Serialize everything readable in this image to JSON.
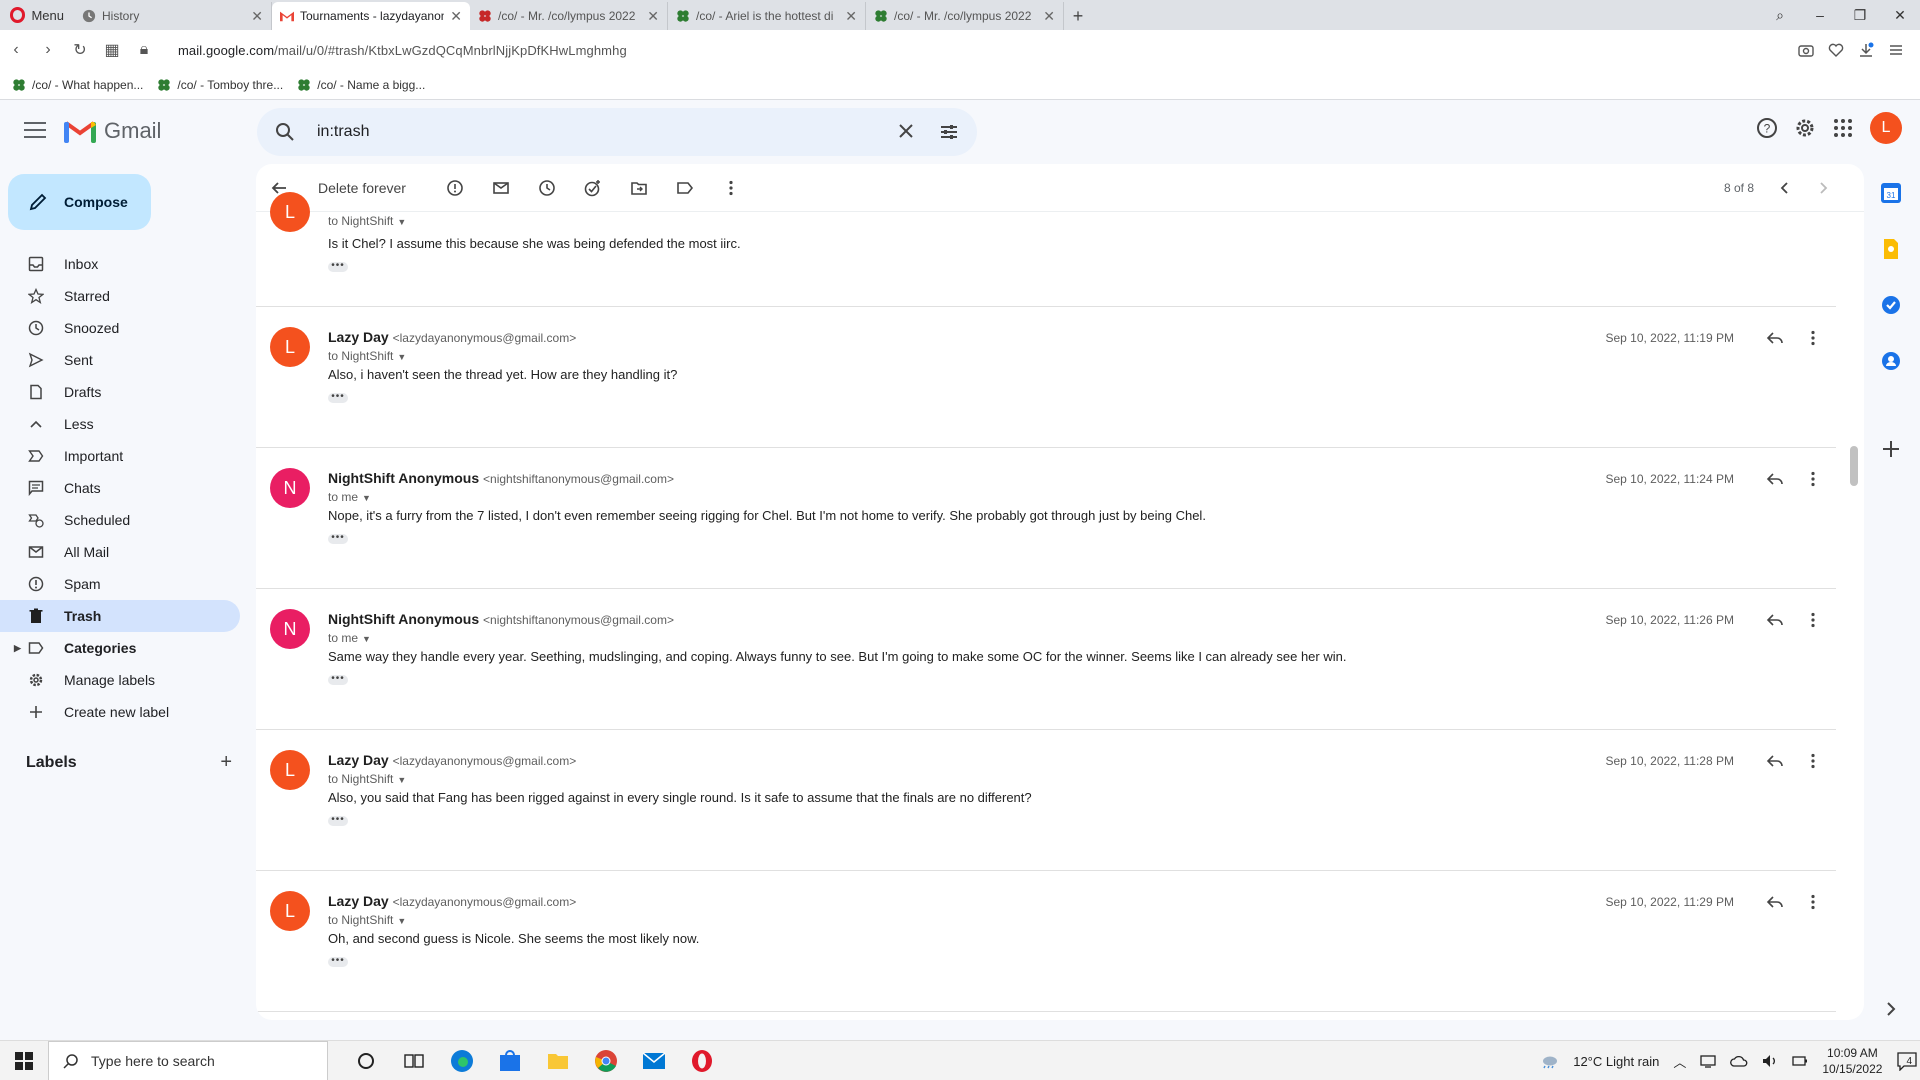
{
  "browser": {
    "menu_label": "Menu",
    "tabs": [
      {
        "title": "History",
        "active": false
      },
      {
        "title": "Tournaments - lazydayanon",
        "active": true
      },
      {
        "title": "/co/ - Mr. /co/lympus 2022",
        "active": false
      },
      {
        "title": "/co/ - Ariel is the hottest di",
        "active": false
      },
      {
        "title": "/co/ - Mr. /co/lympus 2022",
        "active": false
      }
    ],
    "url_domain": "mail.google.com",
    "url_path": "/mail/u/0/#trash/KtbxLwGzdQCqMnbrlNjjKpDfKHwLmghmhg",
    "bookmarks": [
      "/co/ - What happen...",
      "/co/ - Tomboy thre...",
      "/co/ - Name a bigg..."
    ]
  },
  "gmail": {
    "brand": "Gmail",
    "search_value": "in:trash",
    "account_initial": "L",
    "compose_label": "Compose",
    "nav": [
      {
        "label": "Inbox",
        "icon": "inbox-icon"
      },
      {
        "label": "Starred",
        "icon": "star-icon"
      },
      {
        "label": "Snoozed",
        "icon": "clock-icon"
      },
      {
        "label": "Sent",
        "icon": "send-icon"
      },
      {
        "label": "Drafts",
        "icon": "draft-icon"
      },
      {
        "label": "Less",
        "icon": "chevron-up-icon"
      },
      {
        "label": "Important",
        "icon": "important-icon"
      },
      {
        "label": "Chats",
        "icon": "chat-icon"
      },
      {
        "label": "Scheduled",
        "icon": "scheduled-icon"
      },
      {
        "label": "All Mail",
        "icon": "all-mail-icon"
      },
      {
        "label": "Spam",
        "icon": "spam-icon"
      },
      {
        "label": "Trash",
        "icon": "trash-icon"
      },
      {
        "label": "Categories",
        "icon": "label-icon"
      },
      {
        "label": "Manage labels",
        "icon": "gear-icon"
      },
      {
        "label": "Create new label",
        "icon": "plus-icon"
      }
    ],
    "labels_header": "Labels",
    "toolbar": {
      "delete_forever": "Delete forever",
      "pagination": "8 of 8"
    },
    "first_message": {
      "to": "to NightShift",
      "body": "Is it Chel? I assume this because she was being defended the most iirc."
    },
    "messages": [
      {
        "initial": "L",
        "name": "Lazy Day",
        "email": "<lazydayanonymous@gmail.com>",
        "to": "to NightShift",
        "date": "Sep 10, 2022, 11:19 PM",
        "body": "Also, i haven't seen the thread yet. How are they handling it?"
      },
      {
        "initial": "N",
        "name": "NightShift Anonymous",
        "email": "<nightshiftanonymous@gmail.com>",
        "to": "to me",
        "date": "Sep 10, 2022, 11:24 PM",
        "body": "Nope, it's a furry from the 7 listed, I don't even remember seeing rigging for Chel. But I'm not home to verify. She probably got through just by being Chel."
      },
      {
        "initial": "N",
        "name": "NightShift Anonymous",
        "email": "<nightshiftanonymous@gmail.com>",
        "to": "to me",
        "date": "Sep 10, 2022, 11:26 PM",
        "body": "Same way they handle every year. Seething, mudslinging, and coping. Always funny to see. But I'm going to make some OC for the winner. Seems like I can already see her win."
      },
      {
        "initial": "L",
        "name": "Lazy Day",
        "email": "<lazydayanonymous@gmail.com>",
        "to": "to NightShift",
        "date": "Sep 10, 2022, 11:28 PM",
        "body": "Also, you said that Fang has been rigged against in every single round. Is it safe to assume that the finals are no different?"
      },
      {
        "initial": "L",
        "name": "Lazy Day",
        "email": "<lazydayanonymous@gmail.com>",
        "to": "to NightShift",
        "date": "Sep 10, 2022, 11:29 PM",
        "body": "Oh, and second guess is Nicole. She seems the most likely now."
      }
    ]
  },
  "taskbar": {
    "search_placeholder": "Type here to search",
    "weather": "12°C  Light rain",
    "time": "10:09 AM",
    "date": "10/15/2022",
    "notification_count": "4"
  },
  "colors": {
    "accent": "#0b57d0",
    "avatar_l": "#f4511e",
    "avatar_n": "#e91e63",
    "compose_bg": "#c2e7ff",
    "active_nav_bg": "#d3e3fd"
  }
}
